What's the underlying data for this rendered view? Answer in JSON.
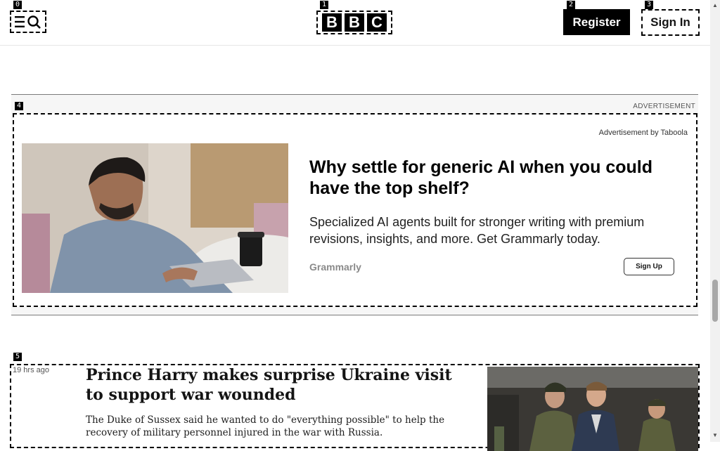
{
  "markers": [
    "0",
    "1",
    "2",
    "3",
    "4",
    "5"
  ],
  "header": {
    "logo_letters": [
      "B",
      "B",
      "C"
    ],
    "register_label": "Register",
    "signin_label": "Sign In"
  },
  "ad": {
    "label": "ADVERTISEMENT",
    "provider": "Advertisement by Taboola",
    "headline": "Why settle for generic AI when you could have the top shelf?",
    "description": "Specialized AI agents built for stronger writing with premium revisions, insights, and more. Get Grammarly today.",
    "brand": "Grammarly",
    "cta": "Sign Up"
  },
  "story": {
    "time": "19 hrs ago",
    "title": "Prince Harry makes surprise Ukraine visit to support war wounded",
    "summary": "The Duke of Sussex said he wanted to do \"everything possible\" to help the recovery of military personnel injured in the war with Russia."
  },
  "icons": {
    "menu": "menu-icon",
    "search": "search-icon"
  }
}
